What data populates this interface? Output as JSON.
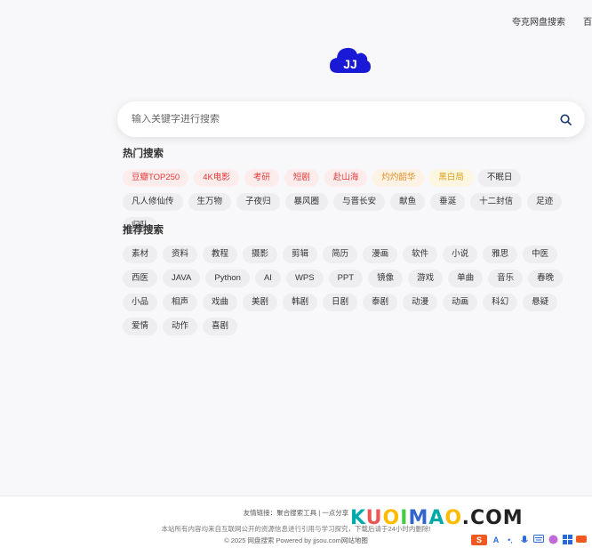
{
  "nav": {
    "links": [
      "夸克网盘搜索",
      "百"
    ]
  },
  "logo": {
    "text": "JJ",
    "color": "#1a1ad6"
  },
  "search": {
    "placeholder": "输入关键字进行搜索"
  },
  "hot": {
    "title": "热门搜索",
    "tags": [
      {
        "label": "豆瓣TOP250",
        "style": "hot-red"
      },
      {
        "label": "4K电影",
        "style": "hot-red"
      },
      {
        "label": "考研",
        "style": "hot-red"
      },
      {
        "label": "短剧",
        "style": "hot-red"
      },
      {
        "label": "赴山海",
        "style": "hot-red"
      },
      {
        "label": "灼灼韶华",
        "style": "hot-orange"
      },
      {
        "label": "黑白局",
        "style": "hot-yellow"
      },
      {
        "label": "不眠日",
        "style": ""
      },
      {
        "label": "凡人修仙传",
        "style": ""
      },
      {
        "label": "生万物",
        "style": ""
      },
      {
        "label": "子夜归",
        "style": ""
      },
      {
        "label": "暴风圈",
        "style": ""
      },
      {
        "label": "与晋长安",
        "style": ""
      },
      {
        "label": "献鱼",
        "style": ""
      },
      {
        "label": "垂涎",
        "style": ""
      },
      {
        "label": "十二封信",
        "style": ""
      },
      {
        "label": "足迹",
        "style": ""
      },
      {
        "label": "归队",
        "style": ""
      }
    ]
  },
  "recommend": {
    "title": "推荐搜索",
    "tags": [
      "素材",
      "资料",
      "教程",
      "摄影",
      "剪辑",
      "简历",
      "漫画",
      "软件",
      "小说",
      "雅思",
      "中医",
      "西医",
      "JAVA",
      "Python",
      "AI",
      "WPS",
      "PPT",
      "镜像",
      "游戏",
      "单曲",
      "音乐",
      "春晚",
      "小品",
      "相声",
      "戏曲",
      "美剧",
      "韩剧",
      "日剧",
      "泰剧",
      "动漫",
      "动画",
      "科幻",
      "悬疑",
      "爱情",
      "动作",
      "喜剧"
    ]
  },
  "footer": {
    "friends_label": "友情链接：",
    "friend_links": [
      "聚合搜索工具",
      "一点分享"
    ],
    "separator": "|",
    "disclaimer": "本站所有内容均来自互联网公开的资源信息进行引用与学习探究，下载后请于24小时内删除!",
    "copyright": "© 2025 网盘搜索 Powered by jjsou.com",
    "sitemap": "网站地图"
  },
  "watermark": {
    "parts": [
      "K",
      "U",
      "O",
      "I",
      "M",
      "A",
      "O",
      ".COM"
    ]
  },
  "ime": {
    "s_label": "S",
    "a_label": "A"
  }
}
